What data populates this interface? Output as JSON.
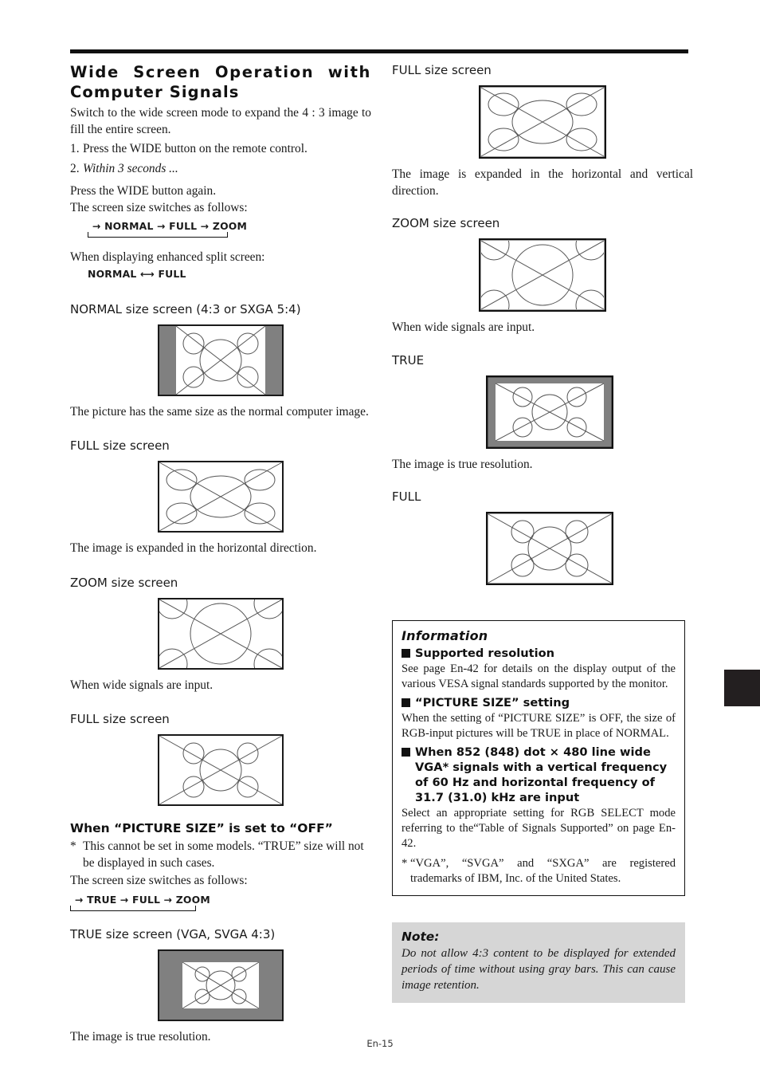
{
  "page": {
    "footer": "En-15",
    "edge_tab_color": "#231f20",
    "gray_bar_color": "#808080",
    "note_bg_color": "#d6d6d6"
  },
  "left_column": {
    "title_line1": "Wide Screen Operation with",
    "title_line2": "Computer Signals",
    "intro": "Switch to the wide screen mode to expand the 4 : 3 image to fill the entire screen.",
    "step1_num": "1.",
    "step1_text": "Press the WIDE button on the remote control.",
    "step2_num": "2.",
    "step2_text": "Within 3 seconds ...",
    "step2_line1": "Press the WIDE button again.",
    "step2_line2": "The screen size switches as follows:",
    "cycle1": "→ NORMAL → FULL → ZOOM",
    "split_intro": "When displaying enhanced split screen:",
    "split_cycle": "NORMAL ⟷  FULL",
    "normal_heading": "NORMAL size screen (4:3 or SXGA 5:4)",
    "normal_caption": "The picture has the same size as the normal computer image.",
    "full_heading": "FULL size screen",
    "full_caption": "The image is expanded in the horizontal direction.",
    "zoom_heading": "ZOOM size screen",
    "zoom_caption": "When wide signals are input.",
    "full2_heading": "FULL size screen",
    "picture_size_heading": "When “PICTURE SIZE” is set to “OFF”",
    "picture_size_star": "*",
    "picture_size_note": "This cannot be set in some models. “TRUE” size will not be displayed in such cases.",
    "picture_size_follows": "The screen size switches as follows:",
    "cycle2": "→ TRUE → FULL → ZOOM",
    "true_heading": "TRUE size screen (VGA, SVGA 4:3)",
    "true_caption": "The image is true resolution."
  },
  "right_column": {
    "full_heading": "FULL size screen",
    "full_caption": "The image is expanded in the horizontal and vertical direction.",
    "zoom_heading": "ZOOM size screen",
    "zoom_caption": "When wide signals are input.",
    "true_heading": "TRUE",
    "true_caption": "The image is true resolution.",
    "full2_heading": "FULL"
  },
  "information": {
    "title": "Information",
    "sub1": "Supported resolution",
    "para1": "See page En-42 for details on the display output of the various VESA signal standards supported by the monitor.",
    "sub2": "“PICTURE SIZE” setting",
    "para2": "When the setting of “PICTURE SIZE” is OFF, the size of RGB-input pictures will be TRUE in place of NORMAL.",
    "sub3": "When 852 (848) dot × 480 line wide VGA* signals with a vertical frequency of 60 Hz and horizontal frequency of 31.7 (31.0) kHz are input",
    "para3": "Select an appropriate setting for RGB SELECT mode referring to the“Table of Signals Supported” on page En-42.",
    "footnote_star": "*",
    "footnote": "“VGA”, “SVGA” and “SXGA” are registered trademarks of IBM, Inc. of the United States."
  },
  "note": {
    "title": "Note:",
    "text": "Do not allow 4:3 content to be displayed for extended periods of time without using gray bars. This can cause image retention."
  }
}
